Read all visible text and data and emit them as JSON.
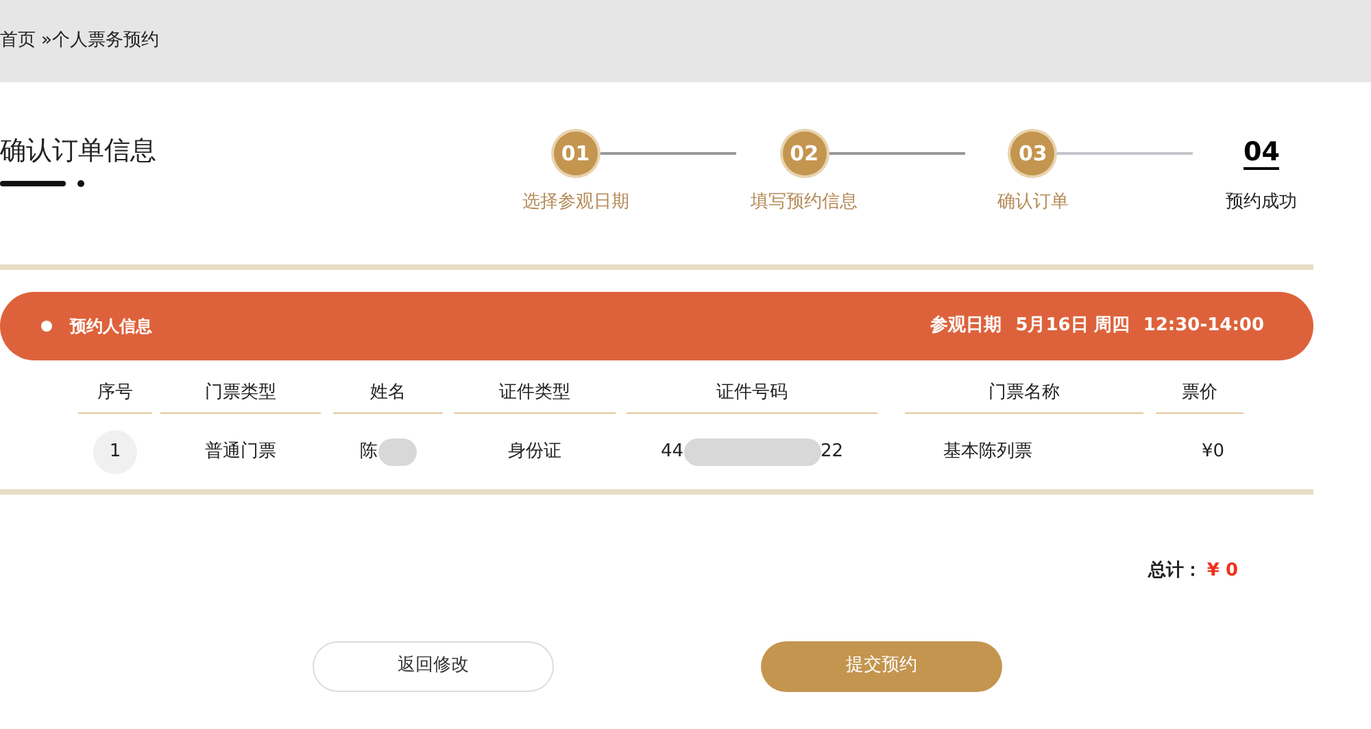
{
  "breadcrumb": {
    "home": "首页",
    "separator": "»",
    "current": "个人票务预约"
  },
  "title": "确认订单信息",
  "steps": [
    {
      "number": "01",
      "label": "选择参观日期",
      "done": true
    },
    {
      "number": "02",
      "label": "填写预约信息",
      "done": true
    },
    {
      "number": "03",
      "label": "确认订单",
      "done": true
    },
    {
      "number": "04",
      "label": "预约成功",
      "done": false
    }
  ],
  "banner": {
    "label": "预约人信息",
    "date_label": "参观日期",
    "date": "5月16日",
    "weekday": "周四",
    "time": "12:30-14:00"
  },
  "table": {
    "columns": [
      "序号",
      "门票类型",
      "姓名",
      "证件类型",
      "证件号码",
      "门票名称",
      "票价"
    ],
    "rows": [
      {
        "index": "1",
        "ticket_type": "普通门票",
        "name": "陈",
        "id_type": "身份证",
        "id_start": "44",
        "id_end": "22",
        "ticket_name": "基本陈列票",
        "price": "¥0"
      }
    ]
  },
  "total": {
    "label": "总计：",
    "value": "¥ 0"
  },
  "buttons": [
    {
      "label": "返回修改",
      "kind": "secondary"
    },
    {
      "label": "提交预约",
      "kind": "primary"
    }
  ]
}
